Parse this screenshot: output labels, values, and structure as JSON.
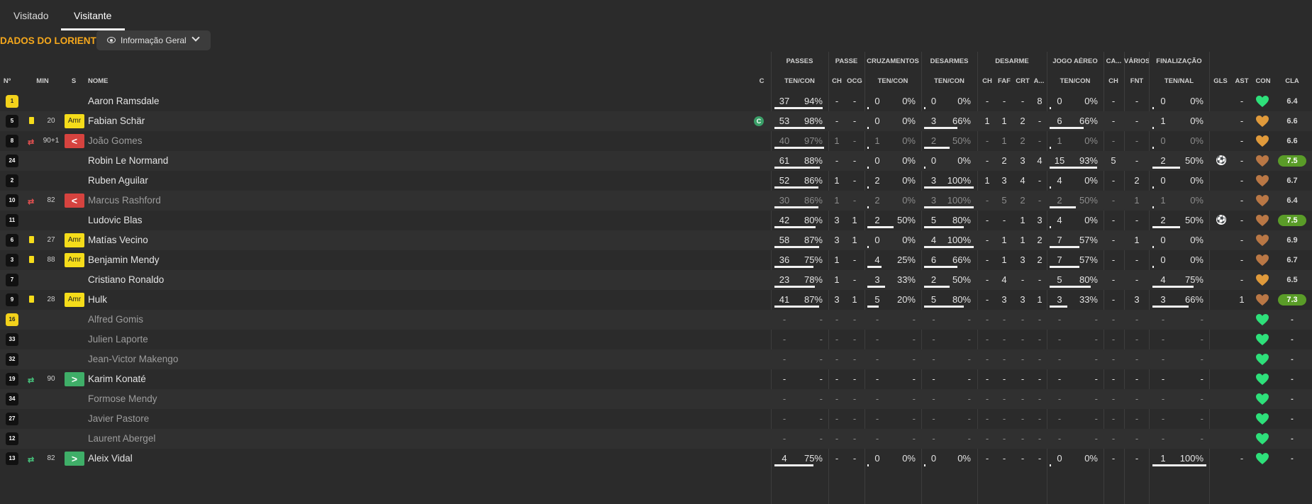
{
  "tabs": [
    {
      "label": "Visitado"
    },
    {
      "label": "Visitante"
    }
  ],
  "team_title": "DADOS DO LORIENT",
  "view_select": {
    "label": "Informação Geral"
  },
  "headers": {
    "groups": {
      "passes": "PASSES",
      "passe": "PASSE",
      "cruzamentos": "CRUZAMENTOS",
      "desarmes": "DESARMES",
      "desarme": "DESARME",
      "jogo_aereo": "JOGO AÉREO",
      "ca": "CA...",
      "varios": "VÁRIOS",
      "finalizacao": "FINALIZAÇÃO"
    },
    "sub": {
      "num": "Nº",
      "min": "MIN",
      "s": "S",
      "nome": "NOME",
      "c": "C",
      "passes_tc": "TEN/CON",
      "passe_ch": "CH",
      "passe_ocg": "OCG",
      "cruz_tc": "TEN/CON",
      "desarmes_tc": "TEN/CON",
      "desarme_ch": "CH",
      "desarme_faf": "FAF",
      "desarme_crt": "CRT",
      "desarme_a": "A...",
      "aereo_tc": "TEN/CON",
      "ca_ch": "CH",
      "varios_fnt": "FNT",
      "final_tn": "TEN/NAL",
      "gls": "GLS",
      "ast": "AST",
      "con": "CON",
      "cla": "CLA"
    }
  },
  "colors": {
    "accent": "#f6a81c",
    "yellow_card": "#f5dc1a",
    "sub_off": "#d6433f",
    "sub_on": "#3fae68",
    "high_rating": "#5a9c28",
    "morale_green": "#2ee07a",
    "morale_orange": "#e09a3b",
    "morale_brown": "#b97745"
  },
  "players": [
    {
      "num": "1",
      "min": "",
      "badge": "",
      "name": "Aaron Ramsdale",
      "c": "",
      "gk": true,
      "yellow": false,
      "sub": "",
      "dim": false,
      "passes": [
        "37",
        "94%"
      ],
      "passes_bar": 0.94,
      "passe": [
        "-",
        "-"
      ],
      "cruz": [
        "0",
        "0%"
      ],
      "cruz_bar": 0,
      "des": [
        "0",
        "0%"
      ],
      "des_bar": 0,
      "desarme": [
        "-",
        "-",
        "-",
        "8"
      ],
      "aereo": [
        "0",
        "0%"
      ],
      "aereo_bar": 0,
      "ca": "-",
      "fnt": "-",
      "fin": [
        "0",
        "0%"
      ],
      "fin_bar": 0,
      "gls": "",
      "ast": "-",
      "morale": "green",
      "cla": "6.4",
      "cla_hi": false
    },
    {
      "num": "5",
      "min": "20",
      "badge": "Amr",
      "name": "Fabian Schär",
      "c": "C",
      "gk": false,
      "yellow": true,
      "sub": "",
      "dim": false,
      "passes": [
        "53",
        "98%"
      ],
      "passes_bar": 0.98,
      "passe": [
        "-",
        "-"
      ],
      "cruz": [
        "0",
        "0%"
      ],
      "cruz_bar": 0,
      "des": [
        "3",
        "66%"
      ],
      "des_bar": 0.66,
      "desarme": [
        "1",
        "1",
        "2",
        "-"
      ],
      "aereo": [
        "6",
        "66%"
      ],
      "aereo_bar": 0.66,
      "ca": "-",
      "fnt": "-",
      "fin": [
        "1",
        "0%"
      ],
      "fin_bar": 0,
      "gls": "",
      "ast": "-",
      "morale": "orange",
      "cla": "6.6",
      "cla_hi": false
    },
    {
      "num": "8",
      "min": "90+1",
      "badge": "<",
      "name": "João Gomes",
      "c": "",
      "gk": false,
      "yellow": false,
      "sub": "off",
      "dim": true,
      "passes": [
        "40",
        "97%"
      ],
      "passes_bar": 0.97,
      "passe": [
        "1",
        "-"
      ],
      "cruz": [
        "1",
        "0%"
      ],
      "cruz_bar": 0,
      "des": [
        "2",
        "50%"
      ],
      "des_bar": 0.5,
      "desarme": [
        "-",
        "1",
        "2",
        "-"
      ],
      "aereo": [
        "1",
        "0%"
      ],
      "aereo_bar": 0,
      "ca": "-",
      "fnt": "-",
      "fin": [
        "0",
        "0%"
      ],
      "fin_bar": 0,
      "gls": "",
      "ast": "-",
      "morale": "orange",
      "cla": "6.6",
      "cla_hi": false
    },
    {
      "num": "24",
      "min": "",
      "badge": "",
      "name": "Robin Le Normand",
      "c": "",
      "gk": false,
      "yellow": false,
      "sub": "",
      "dim": false,
      "passes": [
        "61",
        "88%"
      ],
      "passes_bar": 0.88,
      "passe": [
        "-",
        "-"
      ],
      "cruz": [
        "0",
        "0%"
      ],
      "cruz_bar": 0,
      "des": [
        "0",
        "0%"
      ],
      "des_bar": 0,
      "desarme": [
        "-",
        "2",
        "3",
        "4"
      ],
      "aereo": [
        "15",
        "93%"
      ],
      "aereo_bar": 0.93,
      "ca": "5",
      "fnt": "-",
      "fin": [
        "2",
        "50%"
      ],
      "fin_bar": 0.5,
      "gls": "ball",
      "ast": "-",
      "morale": "brown",
      "cla": "7.5",
      "cla_hi": true
    },
    {
      "num": "2",
      "min": "",
      "badge": "",
      "name": "Ruben Aguilar",
      "c": "",
      "gk": false,
      "yellow": false,
      "sub": "",
      "dim": false,
      "passes": [
        "52",
        "86%"
      ],
      "passes_bar": 0.86,
      "passe": [
        "1",
        "-"
      ],
      "cruz": [
        "2",
        "0%"
      ],
      "cruz_bar": 0,
      "des": [
        "3",
        "100%"
      ],
      "des_bar": 1,
      "desarme": [
        "1",
        "3",
        "4",
        "-"
      ],
      "aereo": [
        "4",
        "0%"
      ],
      "aereo_bar": 0,
      "ca": "-",
      "fnt": "2",
      "fin": [
        "0",
        "0%"
      ],
      "fin_bar": 0,
      "gls": "",
      "ast": "-",
      "morale": "brown",
      "cla": "6.7",
      "cla_hi": false
    },
    {
      "num": "10",
      "min": "82",
      "badge": "<",
      "name": "Marcus Rashford",
      "c": "",
      "gk": false,
      "yellow": false,
      "sub": "off",
      "dim": true,
      "passes": [
        "30",
        "86%"
      ],
      "passes_bar": 0.86,
      "passe": [
        "1",
        "-"
      ],
      "cruz": [
        "2",
        "0%"
      ],
      "cruz_bar": 0,
      "des": [
        "3",
        "100%"
      ],
      "des_bar": 1,
      "desarme": [
        "-",
        "5",
        "2",
        "-"
      ],
      "aereo": [
        "2",
        "50%"
      ],
      "aereo_bar": 0.5,
      "ca": "-",
      "fnt": "1",
      "fin": [
        "1",
        "0%"
      ],
      "fin_bar": 0,
      "gls": "",
      "ast": "-",
      "morale": "brown",
      "cla": "6.4",
      "cla_hi": false
    },
    {
      "num": "11",
      "min": "",
      "badge": "",
      "name": "Ludovic Blas",
      "c": "",
      "gk": false,
      "yellow": false,
      "sub": "",
      "dim": false,
      "passes": [
        "42",
        "80%"
      ],
      "passes_bar": 0.8,
      "passe": [
        "3",
        "1"
      ],
      "cruz": [
        "2",
        "50%"
      ],
      "cruz_bar": 0.5,
      "des": [
        "5",
        "80%"
      ],
      "des_bar": 0.8,
      "desarme": [
        "-",
        "-",
        "1",
        "3"
      ],
      "aereo": [
        "4",
        "0%"
      ],
      "aereo_bar": 0,
      "ca": "-",
      "fnt": "-",
      "fin": [
        "2",
        "50%"
      ],
      "fin_bar": 0.5,
      "gls": "ball",
      "ast": "-",
      "morale": "brown",
      "cla": "7.5",
      "cla_hi": true
    },
    {
      "num": "6",
      "min": "27",
      "badge": "Amr",
      "name": "Matías Vecino",
      "c": "",
      "gk": false,
      "yellow": true,
      "sub": "",
      "dim": false,
      "passes": [
        "58",
        "87%"
      ],
      "passes_bar": 0.87,
      "passe": [
        "3",
        "1"
      ],
      "cruz": [
        "0",
        "0%"
      ],
      "cruz_bar": 0,
      "des": [
        "4",
        "100%"
      ],
      "des_bar": 1,
      "desarme": [
        "-",
        "1",
        "1",
        "2"
      ],
      "aereo": [
        "7",
        "57%"
      ],
      "aereo_bar": 0.57,
      "ca": "-",
      "fnt": "1",
      "fin": [
        "0",
        "0%"
      ],
      "fin_bar": 0,
      "gls": "",
      "ast": "-",
      "morale": "brown",
      "cla": "6.9",
      "cla_hi": false
    },
    {
      "num": "3",
      "min": "88",
      "badge": "Amr",
      "name": "Benjamin Mendy",
      "c": "",
      "gk": false,
      "yellow": true,
      "sub": "",
      "dim": false,
      "passes": [
        "36",
        "75%"
      ],
      "passes_bar": 0.75,
      "passe": [
        "1",
        "-"
      ],
      "cruz": [
        "4",
        "25%"
      ],
      "cruz_bar": 0.25,
      "des": [
        "6",
        "66%"
      ],
      "des_bar": 0.66,
      "desarme": [
        "-",
        "1",
        "3",
        "2"
      ],
      "aereo": [
        "7",
        "57%"
      ],
      "aereo_bar": 0.57,
      "ca": "-",
      "fnt": "-",
      "fin": [
        "0",
        "0%"
      ],
      "fin_bar": 0,
      "gls": "",
      "ast": "-",
      "morale": "brown",
      "cla": "6.7",
      "cla_hi": false
    },
    {
      "num": "7",
      "min": "",
      "badge": "",
      "name": "Cristiano Ronaldo",
      "c": "",
      "gk": false,
      "yellow": false,
      "sub": "",
      "dim": false,
      "passes": [
        "23",
        "78%"
      ],
      "passes_bar": 0.78,
      "passe": [
        "1",
        "-"
      ],
      "cruz": [
        "3",
        "33%"
      ],
      "cruz_bar": 0.33,
      "des": [
        "2",
        "50%"
      ],
      "des_bar": 0.5,
      "desarme": [
        "-",
        "4",
        "-",
        "-"
      ],
      "aereo": [
        "5",
        "80%"
      ],
      "aereo_bar": 0.8,
      "ca": "-",
      "fnt": "-",
      "fin": [
        "4",
        "75%"
      ],
      "fin_bar": 0.75,
      "gls": "",
      "ast": "-",
      "morale": "orange",
      "cla": "6.5",
      "cla_hi": false
    },
    {
      "num": "9",
      "min": "28",
      "badge": "Amr",
      "name": "Hulk",
      "c": "",
      "gk": false,
      "yellow": true,
      "sub": "",
      "dim": false,
      "passes": [
        "41",
        "87%"
      ],
      "passes_bar": 0.87,
      "passe": [
        "3",
        "1"
      ],
      "cruz": [
        "5",
        "20%"
      ],
      "cruz_bar": 0.2,
      "des": [
        "5",
        "80%"
      ],
      "des_bar": 0.8,
      "desarme": [
        "-",
        "3",
        "3",
        "1"
      ],
      "aereo": [
        "3",
        "33%"
      ],
      "aereo_bar": 0.33,
      "ca": "-",
      "fnt": "3",
      "fin": [
        "3",
        "66%"
      ],
      "fin_bar": 0.66,
      "gls": "",
      "ast": "1",
      "morale": "brown",
      "cla": "7.3",
      "cla_hi": true
    },
    {
      "num": "16",
      "min": "",
      "badge": "",
      "name": "Alfred Gomis",
      "c": "",
      "gk": true,
      "yellow": false,
      "sub": "",
      "dim": true,
      "passes": [
        "-",
        "-"
      ],
      "passes_bar": 0,
      "passe": [
        "-",
        "-"
      ],
      "cruz": [
        "-",
        "-"
      ],
      "cruz_bar": 0,
      "des": [
        "-",
        "-"
      ],
      "des_bar": 0,
      "desarme": [
        "-",
        "-",
        "-",
        "-"
      ],
      "aereo": [
        "-",
        "-"
      ],
      "aereo_bar": 0,
      "ca": "-",
      "fnt": "-",
      "fin": [
        "-",
        "-"
      ],
      "fin_bar": 0,
      "gls": "",
      "ast": "",
      "morale": "green",
      "cla": "-",
      "cla_hi": false
    },
    {
      "num": "33",
      "min": "",
      "badge": "",
      "name": "Julien Laporte",
      "c": "",
      "gk": false,
      "yellow": false,
      "sub": "",
      "dim": true,
      "passes": [
        "-",
        "-"
      ],
      "passes_bar": 0,
      "passe": [
        "-",
        "-"
      ],
      "cruz": [
        "-",
        "-"
      ],
      "cruz_bar": 0,
      "des": [
        "-",
        "-"
      ],
      "des_bar": 0,
      "desarme": [
        "-",
        "-",
        "-",
        "-"
      ],
      "aereo": [
        "-",
        "-"
      ],
      "aereo_bar": 0,
      "ca": "-",
      "fnt": "-",
      "fin": [
        "-",
        "-"
      ],
      "fin_bar": 0,
      "gls": "",
      "ast": "",
      "morale": "green",
      "cla": "-",
      "cla_hi": false
    },
    {
      "num": "32",
      "min": "",
      "badge": "",
      "name": "Jean-Victor Makengo",
      "c": "",
      "gk": false,
      "yellow": false,
      "sub": "",
      "dim": true,
      "passes": [
        "-",
        "-"
      ],
      "passes_bar": 0,
      "passe": [
        "-",
        "-"
      ],
      "cruz": [
        "-",
        "-"
      ],
      "cruz_bar": 0,
      "des": [
        "-",
        "-"
      ],
      "des_bar": 0,
      "desarme": [
        "-",
        "-",
        "-",
        "-"
      ],
      "aereo": [
        "-",
        "-"
      ],
      "aereo_bar": 0,
      "ca": "-",
      "fnt": "-",
      "fin": [
        "-",
        "-"
      ],
      "fin_bar": 0,
      "gls": "",
      "ast": "",
      "morale": "green",
      "cla": "-",
      "cla_hi": false
    },
    {
      "num": "19",
      "min": "90",
      "badge": ">",
      "name": "Karim Konaté",
      "c": "",
      "gk": false,
      "yellow": false,
      "sub": "on",
      "dim": false,
      "passes": [
        "-",
        "-"
      ],
      "passes_bar": 0,
      "passe": [
        "-",
        "-"
      ],
      "cruz": [
        "-",
        "-"
      ],
      "cruz_bar": 0,
      "des": [
        "-",
        "-"
      ],
      "des_bar": 0,
      "desarme": [
        "-",
        "-",
        "-",
        "-"
      ],
      "aereo": [
        "-",
        "-"
      ],
      "aereo_bar": 0,
      "ca": "-",
      "fnt": "-",
      "fin": [
        "-",
        "-"
      ],
      "fin_bar": 0,
      "gls": "",
      "ast": "",
      "morale": "green",
      "cla": "-",
      "cla_hi": false
    },
    {
      "num": "34",
      "min": "",
      "badge": "",
      "name": "Formose Mendy",
      "c": "",
      "gk": false,
      "yellow": false,
      "sub": "",
      "dim": true,
      "passes": [
        "-",
        "-"
      ],
      "passes_bar": 0,
      "passe": [
        "-",
        "-"
      ],
      "cruz": [
        "-",
        "-"
      ],
      "cruz_bar": 0,
      "des": [
        "-",
        "-"
      ],
      "des_bar": 0,
      "desarme": [
        "-",
        "-",
        "-",
        "-"
      ],
      "aereo": [
        "-",
        "-"
      ],
      "aereo_bar": 0,
      "ca": "-",
      "fnt": "-",
      "fin": [
        "-",
        "-"
      ],
      "fin_bar": 0,
      "gls": "",
      "ast": "",
      "morale": "green",
      "cla": "-",
      "cla_hi": false
    },
    {
      "num": "27",
      "min": "",
      "badge": "",
      "name": "Javier Pastore",
      "c": "",
      "gk": false,
      "yellow": false,
      "sub": "",
      "dim": true,
      "passes": [
        "-",
        "-"
      ],
      "passes_bar": 0,
      "passe": [
        "-",
        "-"
      ],
      "cruz": [
        "-",
        "-"
      ],
      "cruz_bar": 0,
      "des": [
        "-",
        "-"
      ],
      "des_bar": 0,
      "desarme": [
        "-",
        "-",
        "-",
        "-"
      ],
      "aereo": [
        "-",
        "-"
      ],
      "aereo_bar": 0,
      "ca": "-",
      "fnt": "-",
      "fin": [
        "-",
        "-"
      ],
      "fin_bar": 0,
      "gls": "",
      "ast": "",
      "morale": "green",
      "cla": "-",
      "cla_hi": false
    },
    {
      "num": "12",
      "min": "",
      "badge": "",
      "name": "Laurent Abergel",
      "c": "",
      "gk": false,
      "yellow": false,
      "sub": "",
      "dim": true,
      "passes": [
        "-",
        "-"
      ],
      "passes_bar": 0,
      "passe": [
        "-",
        "-"
      ],
      "cruz": [
        "-",
        "-"
      ],
      "cruz_bar": 0,
      "des": [
        "-",
        "-"
      ],
      "des_bar": 0,
      "desarme": [
        "-",
        "-",
        "-",
        "-"
      ],
      "aereo": [
        "-",
        "-"
      ],
      "aereo_bar": 0,
      "ca": "-",
      "fnt": "-",
      "fin": [
        "-",
        "-"
      ],
      "fin_bar": 0,
      "gls": "",
      "ast": "",
      "morale": "green",
      "cla": "-",
      "cla_hi": false
    },
    {
      "num": "13",
      "min": "82",
      "badge": ">",
      "name": "Aleix Vidal",
      "c": "",
      "gk": false,
      "yellow": false,
      "sub": "on",
      "dim": false,
      "passes": [
        "4",
        "75%"
      ],
      "passes_bar": 0.75,
      "passe": [
        "-",
        "-"
      ],
      "cruz": [
        "0",
        "0%"
      ],
      "cruz_bar": 0,
      "des": [
        "0",
        "0%"
      ],
      "des_bar": 0,
      "desarme": [
        "-",
        "-",
        "-",
        "-"
      ],
      "aereo": [
        "0",
        "0%"
      ],
      "aereo_bar": 0,
      "ca": "-",
      "fnt": "-",
      "fin": [
        "1",
        "100%"
      ],
      "fin_bar": 1,
      "gls": "",
      "ast": "-",
      "morale": "green",
      "cla": "-",
      "cla_hi": false
    }
  ]
}
